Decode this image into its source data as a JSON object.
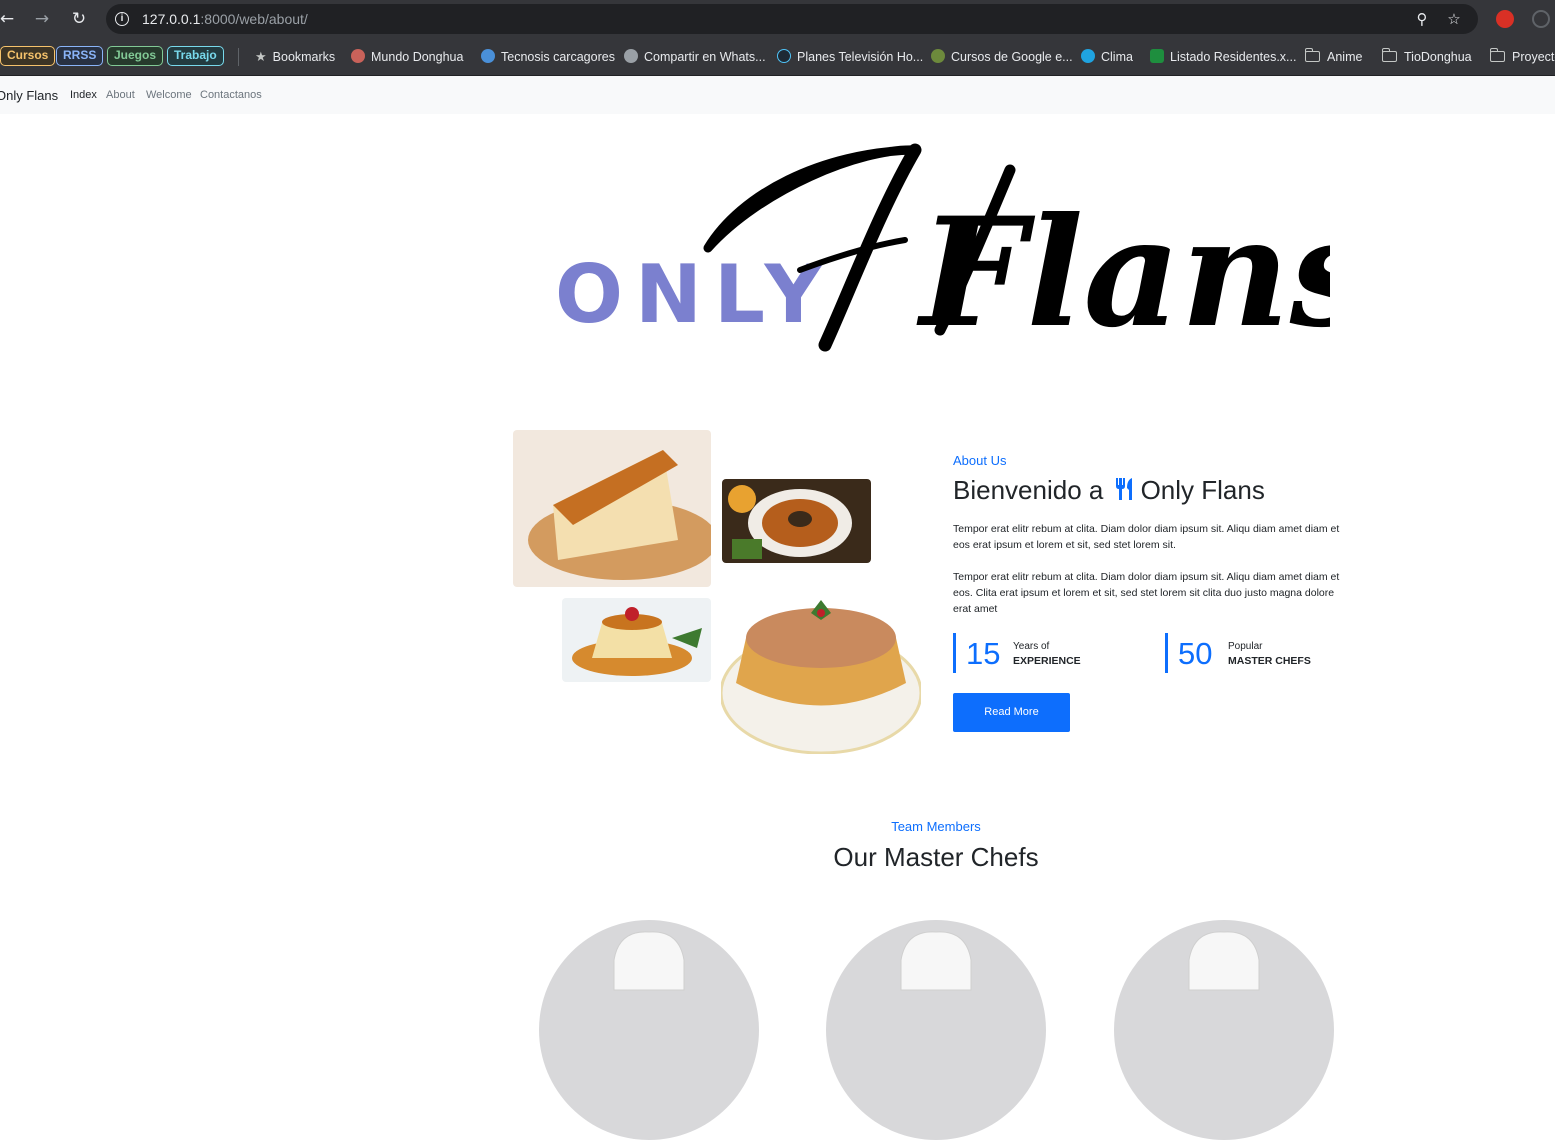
{
  "browser": {
    "url_host": "127.0.0.1",
    "url_path": ":8000/web/about/"
  },
  "bookmarks": {
    "pills": [
      {
        "label": "Cursos",
        "color": "#f5c26b"
      },
      {
        "label": "RRSS",
        "color": "#8ab4f8"
      },
      {
        "label": "Juegos",
        "color": "#81c995"
      },
      {
        "label": "Trabajo",
        "color": "#78d9ec"
      }
    ],
    "items": [
      "Bookmarks",
      "Mundo Donghua",
      "Tecnosis carcagores",
      "Compartir en Whats...",
      "Planes Televisión Ho...",
      "Cursos de Google e...",
      "Clima",
      "Listado Residentes.x...",
      "Anime",
      "TioDonghua",
      "Proyecto"
    ]
  },
  "navbar": {
    "brand": "Only Flans",
    "links": [
      "Index",
      "About",
      "Welcome",
      "Contactanos"
    ]
  },
  "logo": {
    "only": "ONLY",
    "flans": "Flans"
  },
  "about": {
    "eyebrow": "About Us",
    "title_prefix": "Bienvenido a",
    "title_suffix": "Only Flans",
    "paragraph1": "Tempor erat elitr rebum at clita. Diam dolor diam ipsum sit. Aliqu diam amet diam et eos erat ipsum et lorem et sit, sed stet lorem sit.",
    "paragraph2": "Tempor erat elitr rebum at clita. Diam dolor diam ipsum sit. Aliqu diam amet diam et eos. Clita erat ipsum et lorem et sit, sed stet lorem sit clita duo justo magna dolore erat amet",
    "stats": [
      {
        "number": "15",
        "line1": "Years of",
        "line2": "EXPERIENCE"
      },
      {
        "number": "50",
        "line1": "Popular",
        "line2": "MASTER CHEFS"
      }
    ],
    "button": "Read More"
  },
  "team": {
    "eyebrow": "Team Members",
    "title": "Our Master Chefs"
  },
  "colors": {
    "primary": "#0d6efd",
    "logo_only": "#7b80cf"
  }
}
